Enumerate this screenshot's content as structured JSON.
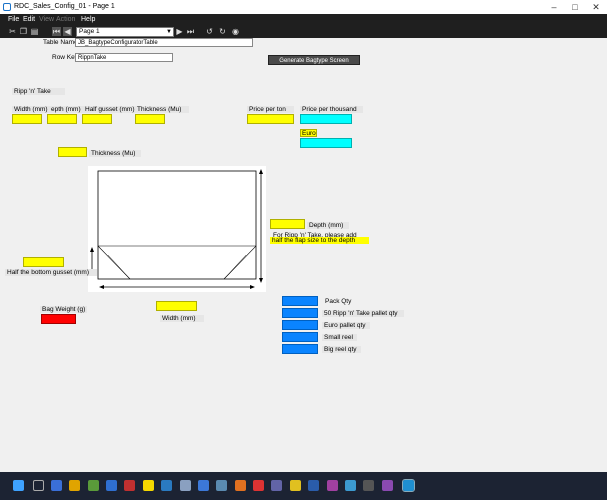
{
  "window": {
    "title": "RDC_Sales_Config_01 - Page 1"
  },
  "menu": {
    "file": "File",
    "edit": "Edit",
    "view": "View",
    "action": "Action",
    "help": "Help"
  },
  "toolbar": {
    "page": "Page 1"
  },
  "form": {
    "table_name_label": "Table Name",
    "table_name_value": "JB_BagtypeConfiguratorTable",
    "row_key_label": "Row Key",
    "row_key_value": "RippnTake",
    "generate_label": "Generate Bagtype Screen",
    "heading": "Ripp 'n' Take",
    "width_label": "Width (mm)",
    "depth_label": "epth (mm)",
    "half_gusset_label": "Half gusset (mm)",
    "thickness_label": "Thickness (Mu)",
    "price_per_ton_label": "Price per ton",
    "price_per_thousand_label": "Price per thousand",
    "currency": "Euro",
    "thickness2_label": "Thickness (Mu)",
    "depth2_label": "Depth (mm)",
    "note_line1": "For Ripp 'n' Take, please add",
    "note_line2": "half the flap size to the depth",
    "half_bottom_label": "Half the bottom gusset (mm)",
    "bag_weight_label": "Bag Weight (g)",
    "width2_label": "Width (mm)",
    "pack_qty": "Pack Qty",
    "pallet50": "50 Ripp 'n' Take pallet qty",
    "euro_pallet": "Euro pallet qty",
    "small_reel": "Small reel",
    "big_reel": "Big reel qty"
  },
  "colors": {
    "input_yellow": "#ffff00",
    "input_cyan": "#00ffff",
    "input_red": "#ff0000",
    "input_blue": "#0a84ff",
    "dark_bar": "#1f1f1f"
  }
}
